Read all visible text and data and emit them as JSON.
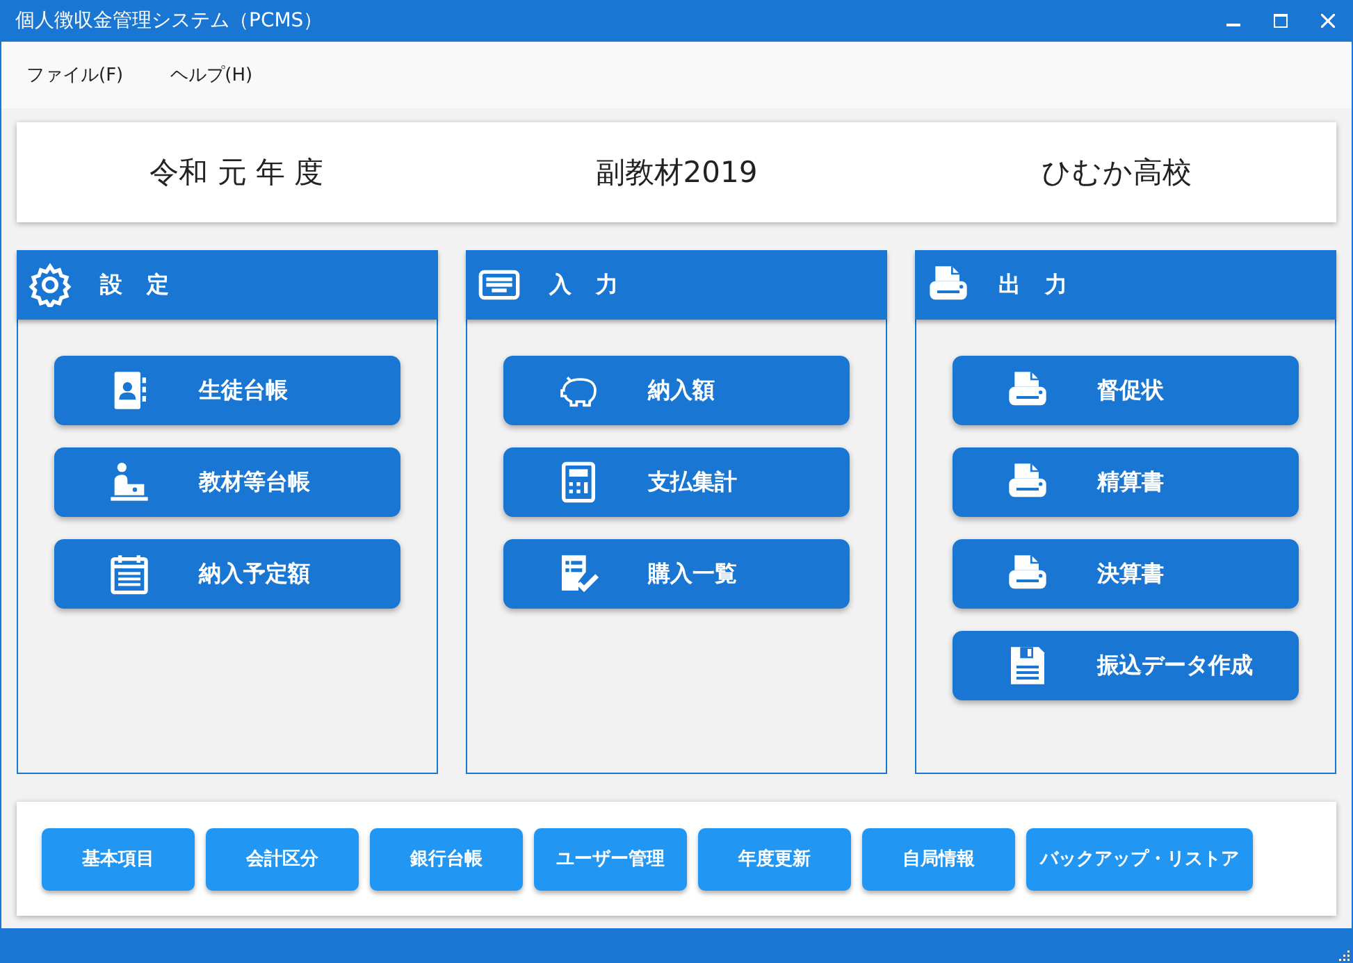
{
  "window": {
    "title": "個人徴収金管理システム（PCMS）"
  },
  "menu": [
    "ファイル(F)",
    "ヘルプ(H)"
  ],
  "header": {
    "year": "令和 元 年 度",
    "subject": "副教材2019",
    "school": "ひむか高校"
  },
  "panels": [
    {
      "title": "設 定",
      "buttons": [
        "生徒台帳",
        "教材等台帳",
        "納入予定額"
      ]
    },
    {
      "title": "入 力",
      "buttons": [
        "納入額",
        "支払集計",
        "購入一覧"
      ]
    },
    {
      "title": "出 力",
      "buttons": [
        "督促状",
        "精算書",
        "決算書",
        "振込データ作成"
      ]
    }
  ],
  "footer_buttons": [
    "基本項目",
    "会計区分",
    "銀行台帳",
    "ユーザー管理",
    "年度更新",
    "自局情報",
    "バックアップ・リストア"
  ]
}
